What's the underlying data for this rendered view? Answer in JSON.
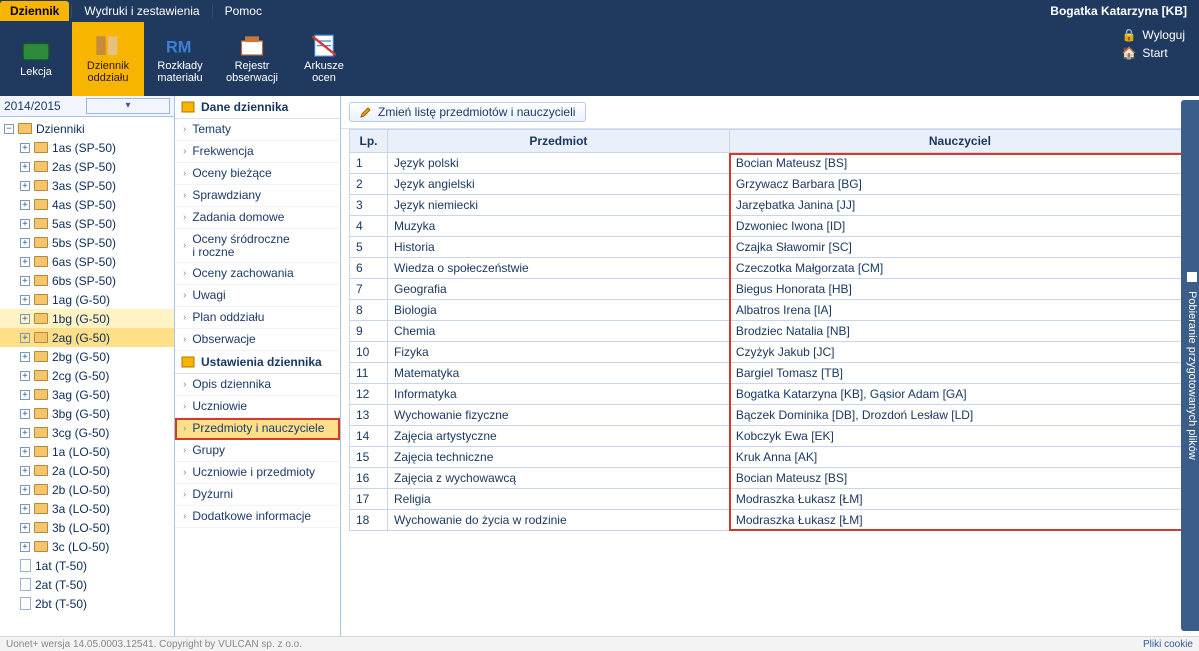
{
  "header": {
    "tabs": [
      "Dziennik",
      "Wydruki i zestawienia",
      "Pomoc"
    ],
    "active_tab": 0,
    "user": "Bogatka Katarzyna [KB]",
    "logout": "Wyloguj",
    "start": "Start"
  },
  "ribbon": [
    {
      "label": "Lekcja"
    },
    {
      "label": "Dziennik\noddziału",
      "active": true
    },
    {
      "label": "Rozkłady\nmateriału"
    },
    {
      "label": "Rejestr\nobserwacji"
    },
    {
      "label": "Arkusze\nocen"
    }
  ],
  "year": "2014/2015",
  "tree_root": "Dzienniki",
  "tree": [
    {
      "label": "1as (SP-50)"
    },
    {
      "label": "2as (SP-50)"
    },
    {
      "label": "3as (SP-50)"
    },
    {
      "label": "4as (SP-50)"
    },
    {
      "label": "5as (SP-50)"
    },
    {
      "label": "5bs (SP-50)"
    },
    {
      "label": "6as (SP-50)"
    },
    {
      "label": "6bs (SP-50)"
    },
    {
      "label": "1ag (G-50)"
    },
    {
      "label": "1bg (G-50)",
      "highlight": true
    },
    {
      "label": "2ag (G-50)",
      "selected": true
    },
    {
      "label": "2bg (G-50)"
    },
    {
      "label": "2cg (G-50)"
    },
    {
      "label": "3ag (G-50)"
    },
    {
      "label": "3bg (G-50)"
    },
    {
      "label": "3cg (G-50)"
    },
    {
      "label": "1a (LO-50)"
    },
    {
      "label": "2a (LO-50)"
    },
    {
      "label": "2b (LO-50)"
    },
    {
      "label": "3a (LO-50)"
    },
    {
      "label": "3b (LO-50)"
    },
    {
      "label": "3c (LO-50)"
    },
    {
      "label": "1at (T-50)",
      "file": true
    },
    {
      "label": "2at (T-50)",
      "file": true
    },
    {
      "label": "2bt (T-50)",
      "file": true
    }
  ],
  "sections": {
    "dane": {
      "title": "Dane dziennika",
      "items": [
        "Tematy",
        "Frekwencja",
        "Oceny bieżące",
        "Sprawdziany",
        "Zadania domowe",
        "Oceny śródroczne\ni roczne",
        "Oceny zachowania",
        "Uwagi",
        "Plan oddziału",
        "Obserwacje"
      ]
    },
    "ustawienia": {
      "title": "Ustawienia dziennika",
      "items": [
        "Opis dziennika",
        "Uczniowie",
        "Przedmioty i nauczyciele",
        "Grupy",
        "Uczniowie i przedmioty",
        "Dyżurni",
        "Dodatkowe informacje"
      ],
      "selected": 2
    }
  },
  "toolbar": {
    "edit_btn": "Zmień listę przedmiotów i nauczycieli"
  },
  "table": {
    "headers": [
      "Lp.",
      "Przedmiot",
      "Nauczyciel"
    ],
    "rows": [
      {
        "lp": "1",
        "subj": "Język polski",
        "teach": "Bocian Mateusz [BS]"
      },
      {
        "lp": "2",
        "subj": "Język angielski",
        "teach": "Grzywacz Barbara [BG]"
      },
      {
        "lp": "3",
        "subj": "Język niemiecki",
        "teach": "Jarzębatka Janina [JJ]"
      },
      {
        "lp": "4",
        "subj": "Muzyka",
        "teach": "Dzwoniec Iwona [ID]"
      },
      {
        "lp": "5",
        "subj": "Historia",
        "teach": "Czajka Sławomir [SC]"
      },
      {
        "lp": "6",
        "subj": "Wiedza o społeczeństwie",
        "teach": "Czeczotka Małgorzata [CM]"
      },
      {
        "lp": "7",
        "subj": "Geografia",
        "teach": "Biegus Honorata [HB]"
      },
      {
        "lp": "8",
        "subj": "Biologia",
        "teach": "Albatros Irena [IA]"
      },
      {
        "lp": "9",
        "subj": "Chemia",
        "teach": "Brodziec Natalia [NB]"
      },
      {
        "lp": "10",
        "subj": "Fizyka",
        "teach": "Czyżyk Jakub [JC]"
      },
      {
        "lp": "11",
        "subj": "Matematyka",
        "teach": "Bargiel Tomasz [TB]"
      },
      {
        "lp": "12",
        "subj": "Informatyka",
        "teach": "Bogatka Katarzyna [KB], Gąsior Adam [GA]"
      },
      {
        "lp": "13",
        "subj": "Wychowanie fizyczne",
        "teach": "Bączek Dominika [DB], Drozdoń Lesław [LD]"
      },
      {
        "lp": "14",
        "subj": "Zajęcia artystyczne",
        "teach": "Kobczyk Ewa [EK]"
      },
      {
        "lp": "15",
        "subj": "Zajęcia techniczne",
        "teach": "Kruk Anna [AK]"
      },
      {
        "lp": "16",
        "subj": "Zajęcia z wychowawcą",
        "teach": "Bocian Mateusz [BS]"
      },
      {
        "lp": "17",
        "subj": "Religia",
        "teach": "Modraszka Łukasz [ŁM]"
      },
      {
        "lp": "18",
        "subj": "Wychowanie do życia w rodzinie",
        "teach": "Modraszka Łukasz [ŁM]"
      }
    ]
  },
  "side_tab": "Pobieranie przygotowanych plików",
  "footer": {
    "version": "Uonet+ wersja 14.05.0003.12541. Copyright by VULCAN sp. z o.o.",
    "cookies": "Pliki cookie"
  }
}
